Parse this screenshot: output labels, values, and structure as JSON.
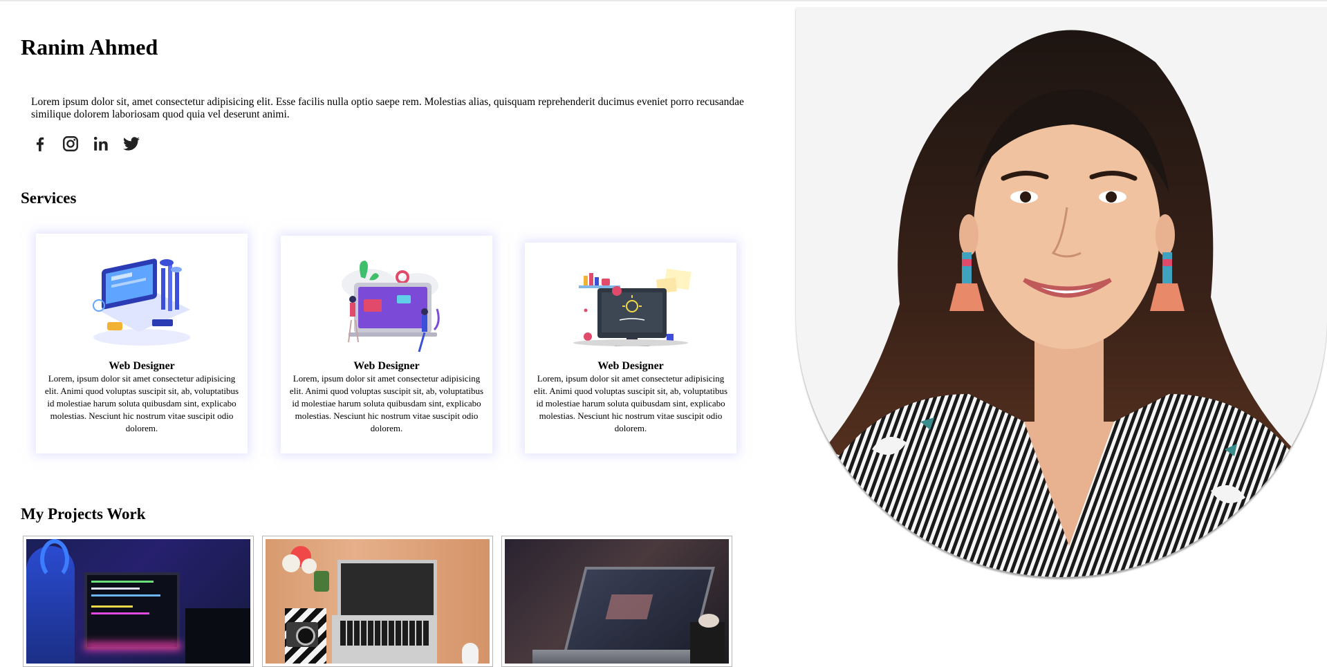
{
  "profile": {
    "name": "Ranim Ahmed",
    "intro": "Lorem ipsum dolor sit, amet consectetur adipisicing elit. Esse facilis nulla optio saepe rem. Molestias alias, quisquam reprehenderit ducimus eveniet porro recusandae similique dolorem laboriosam quod quia vel deserunt animi."
  },
  "socials": [
    {
      "icon": "facebook-icon"
    },
    {
      "icon": "instagram-icon"
    },
    {
      "icon": "linkedin-icon"
    },
    {
      "icon": "twitter-icon"
    }
  ],
  "services": {
    "title": "Services",
    "cards": [
      {
        "title": "Web Designer",
        "text": "Lorem, ipsum dolor sit amet consectetur adipisicing elit. Animi quod voluptas suscipit sit, ab, voluptatibus id molestiae harum soluta quibusdam sint, explicabo molestias. Nesciunt hic nostrum vitae suscipit odio dolorem."
      },
      {
        "title": "Web Designer",
        "text": "Lorem, ipsum dolor sit amet consectetur adipisicing elit. Animi quod voluptas suscipit sit, ab, voluptatibus id molestiae harum soluta quibusdam sint, explicabo molestias. Nesciunt hic nostrum vitae suscipit odio dolorem."
      },
      {
        "title": "Web Designer",
        "text": "Lorem, ipsum dolor sit amet consectetur adipisicing elit. Animi quod voluptas suscipit sit, ab, voluptatibus id molestiae harum soluta quibusdam sint, explicabo molestias. Nesciunt hic nostrum vitae suscipit odio dolorem."
      }
    ]
  },
  "projects": {
    "title": "My Projects Work"
  },
  "colors": {
    "card_shadow": "#cdd0ff",
    "illus_blue": "#3b4fd8",
    "illus_purple": "#7b4bd8",
    "illus_dark": "#2f3742"
  }
}
